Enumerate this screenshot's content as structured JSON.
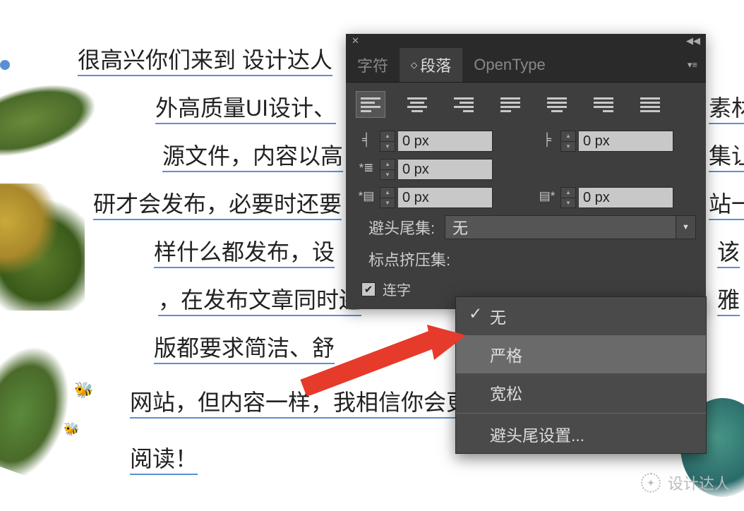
{
  "canvas": {
    "lines": [
      "很高兴你们来到 设计达人",
      "外高质量UI设计、",
      "源文件，内容以高",
      "研才会发布，必要时还要",
      "样什么都发布，设",
      "，在发布文章同时还",
      "版都要求简洁、舒",
      "网站，但内容一样，我相信你会更",
      "阅读！"
    ],
    "right_fragments": [
      "素材",
      "集让",
      "站一",
      "该",
      "雅"
    ]
  },
  "panel": {
    "tabs": {
      "character": "字符",
      "paragraph": "段落",
      "opentype": "OpenType"
    },
    "align": {
      "selected": 0
    },
    "indents": {
      "left": "0 px",
      "right": "0 px",
      "first_line": "0 px",
      "space_before": "0 px",
      "space_after": "0 px"
    },
    "kinsoku_label": "避头尾集:",
    "kinsoku_value": "无",
    "mojikumi_label": "标点挤压集:",
    "hyphenate_label": "连字"
  },
  "dropdown": {
    "items": [
      "无",
      "严格",
      "宽松",
      "避头尾设置..."
    ],
    "checked_index": 0,
    "highlight_index": 1
  },
  "watermark": "设计达人"
}
